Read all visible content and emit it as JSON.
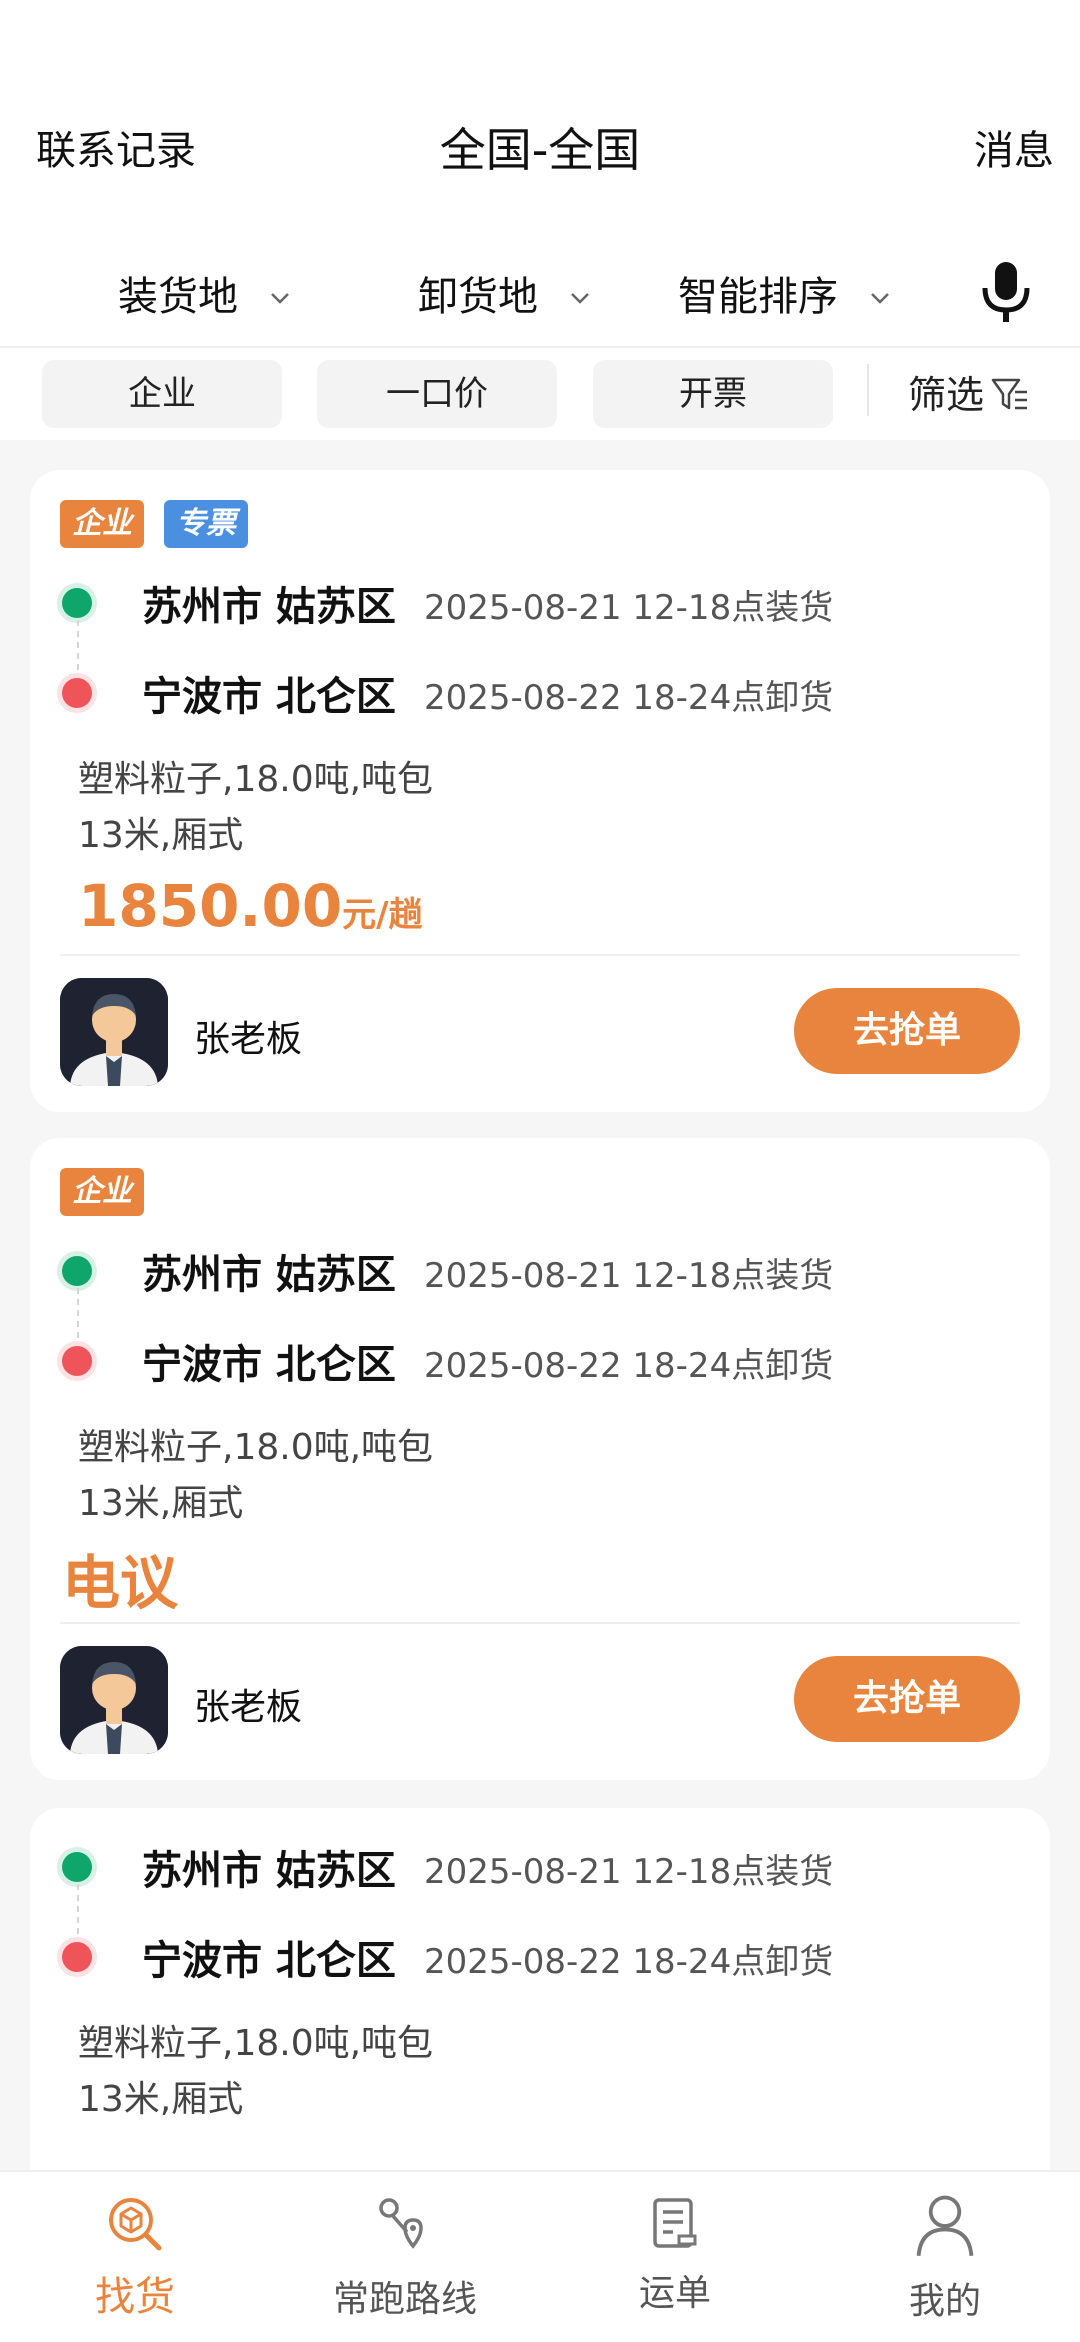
{
  "header": {
    "left_link": "联系记录",
    "title": "全国-全国",
    "right_link": "消息"
  },
  "dropdowns": [
    {
      "label": "装货地"
    },
    {
      "label": "卸货地"
    },
    {
      "label": "智能排序"
    }
  ],
  "chips": [
    "企业",
    "一口价",
    "开票"
  ],
  "filter_label": "筛选",
  "cards": [
    {
      "tags": [
        "企业",
        "专票"
      ],
      "origin": "苏州市 姑苏区",
      "origin_time": "2025-08-21 12-18点装货",
      "dest": "宁波市 北仑区",
      "dest_time": "2025-08-22 18-24点卸货",
      "cargo_line1": "塑料粒子,18.0吨,吨包",
      "cargo_line2": "13米,厢式",
      "price": "1850.00",
      "price_unit": "元/趟",
      "contact": "张老板",
      "action": "去抢单"
    },
    {
      "tags": [
        "企业"
      ],
      "origin": "苏州市 姑苏区",
      "origin_time": "2025-08-21 12-18点装货",
      "dest": "宁波市 北仑区",
      "dest_time": "2025-08-22 18-24点卸货",
      "cargo_line1": "塑料粒子,18.0吨,吨包",
      "cargo_line2": "13米,厢式",
      "price_text": "电议",
      "contact": "张老板",
      "action": "去抢单"
    },
    {
      "origin": "苏州市 姑苏区",
      "origin_time": "2025-08-21 12-18点装货",
      "dest": "宁波市 北仑区",
      "dest_time": "2025-08-22 18-24点卸货",
      "cargo_line1": "塑料粒子,18.0吨,吨包",
      "cargo_line2": "13米,厢式"
    }
  ],
  "tabbar": [
    {
      "label": "找货",
      "icon": "box-search-icon",
      "active": true
    },
    {
      "label": "常跑路线",
      "icon": "route-icon"
    },
    {
      "label": "运单",
      "icon": "waybill-icon"
    },
    {
      "label": "我的",
      "icon": "person-icon"
    }
  ],
  "colors": {
    "accent": "#e8843d",
    "tag_blue": "#4a8fe0",
    "origin_dot": "#0ea66b",
    "dest_dot": "#f0545b"
  }
}
